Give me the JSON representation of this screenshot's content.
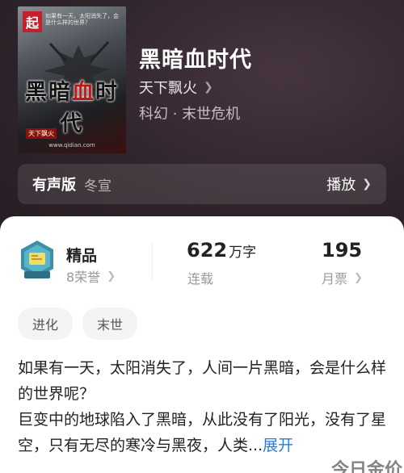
{
  "book": {
    "title": "黑暗血时代",
    "author": "天下飘火",
    "genre": "科幻 · 末世危机"
  },
  "cover": {
    "badge": "起",
    "tagline": "如果有一天，太阳消失了，会是什么样的世界？",
    "title_prefix": "黑暗",
    "title_red": "血",
    "title_suffix": "时代",
    "author_tag": "天下飘火",
    "url": "www.qidian.com"
  },
  "audio": {
    "label": "有声版",
    "narrator": "冬宣",
    "play": "播放"
  },
  "stats": {
    "tier": "精品",
    "honor": "8荣誉",
    "words_num": "622",
    "words_unit": "万字",
    "status": "连载",
    "votes": "195",
    "votes_label": "月票"
  },
  "tags": [
    "进化",
    "末世"
  ],
  "description": {
    "line1": "如果有一天，太阳消失了，人间一片黑暗，会是什么样的世界呢？",
    "line2": "巨变中的地球陷入了黑暗，从此没有了阳光，没有了星空，只有无尽的寒冷与黑夜，人类...",
    "expand": "展开"
  },
  "watermark": "今日金价",
  "icons": {
    "chevron": "chevron-right-icon",
    "medal": "medal-icon"
  }
}
